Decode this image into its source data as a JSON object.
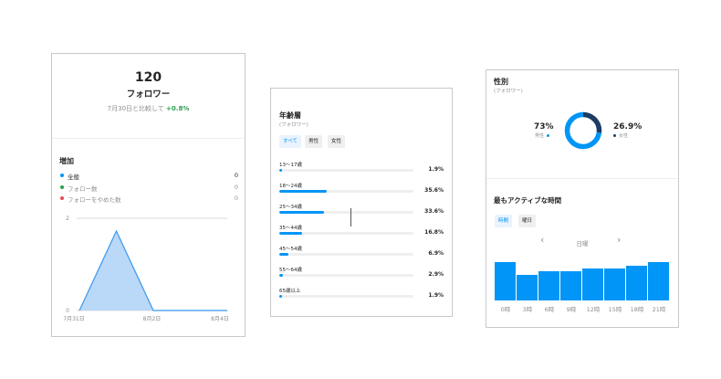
{
  "followers": {
    "count": "120",
    "label": "フォロワー",
    "compare_text": "7月30日と比較して",
    "compare_pct": "+0.8%",
    "growth_title": "増加",
    "rows": [
      {
        "label": "全般",
        "value": "0",
        "color": "#0095f6"
      },
      {
        "label": "フォロー数",
        "value": "0",
        "color": "#2e9e4f"
      },
      {
        "label": "フォローをやめた数",
        "value": "0",
        "color": "#ed4956"
      }
    ],
    "chart": {
      "y_ticks": [
        "2",
        "0"
      ],
      "x_labels": [
        "7月31日",
        "8月2日",
        "8月4日"
      ],
      "values": [
        0,
        2,
        0,
        0,
        0
      ],
      "ylim": [
        0,
        2
      ]
    }
  },
  "age": {
    "title": "年齢層",
    "subtitle": "(フォロワー)",
    "tabs": [
      {
        "label": "すべて",
        "active": true
      },
      {
        "label": "男性",
        "active": false
      },
      {
        "label": "女性",
        "active": false
      }
    ],
    "rows": [
      {
        "label": "13〜17歳",
        "pct": "1.9%",
        "value": 1.9
      },
      {
        "label": "18〜24歳",
        "pct": "35.6%",
        "value": 35.6
      },
      {
        "label": "25〜34歳",
        "pct": "33.6%",
        "value": 33.6
      },
      {
        "label": "35〜44歳",
        "pct": "16.8%",
        "value": 16.8
      },
      {
        "label": "45〜54歳",
        "pct": "6.9%",
        "value": 6.9
      },
      {
        "label": "55〜64歳",
        "pct": "2.9%",
        "value": 2.9
      },
      {
        "label": "65歳以上",
        "pct": "1.9%",
        "value": 1.9
      }
    ]
  },
  "gender": {
    "title": "性別",
    "subtitle": "(フォロワー)",
    "male": {
      "pct": "73%",
      "label": "男性",
      "value": 73,
      "color": "#0095f6"
    },
    "female": {
      "pct": "26.9%",
      "label": "女性",
      "value": 26.9,
      "color": "#1c3d63"
    }
  },
  "active_times": {
    "title": "最もアクティブな時間",
    "tabs": [
      {
        "label": "時間",
        "active": true
      },
      {
        "label": "曜日",
        "active": false
      }
    ],
    "day_label": "日曜",
    "prev_icon": "chevron-left-icon",
    "next_icon": "chevron-right-icon",
    "hours": [
      "0時",
      "3時",
      "6時",
      "9時",
      "12時",
      "15時",
      "18時",
      "21時"
    ],
    "values": [
      42,
      28,
      32,
      32,
      35,
      35,
      38,
      42
    ],
    "ymax": 46,
    "color": "#0095f6"
  }
}
